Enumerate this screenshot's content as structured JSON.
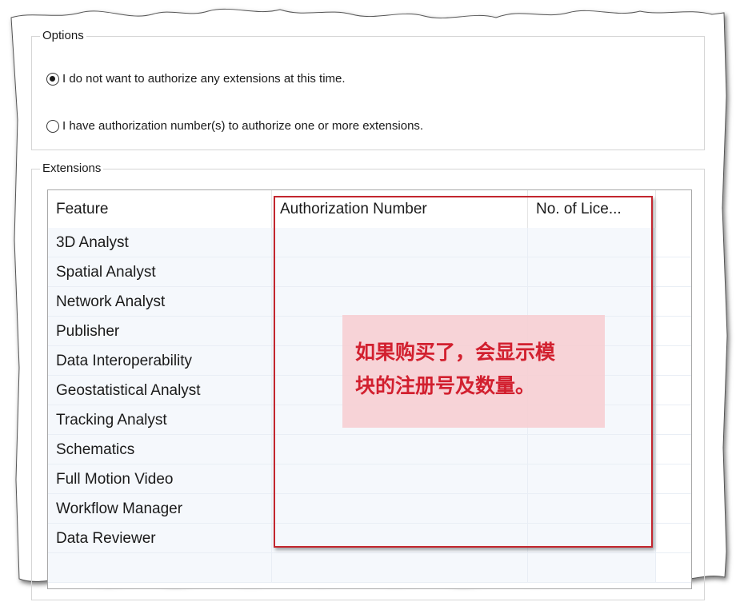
{
  "options": {
    "legend": "Options",
    "radio_no_authorize": {
      "label": "I do not want to authorize any extensions at this time.",
      "checked": true
    },
    "radio_have_numbers": {
      "label": "I have authorization number(s) to authorize one or more extensions.",
      "checked": false
    }
  },
  "extensions": {
    "legend": "Extensions",
    "columns": [
      "Feature",
      "Authorization Number",
      "No. of Lice..."
    ],
    "rows": [
      {
        "feature": "3D Analyst",
        "auth": "",
        "count": ""
      },
      {
        "feature": "Spatial Analyst",
        "auth": "",
        "count": ""
      },
      {
        "feature": "Network Analyst",
        "auth": "",
        "count": ""
      },
      {
        "feature": "Publisher",
        "auth": "",
        "count": ""
      },
      {
        "feature": "Data Interoperability",
        "auth": "",
        "count": ""
      },
      {
        "feature": "Geostatistical Analyst",
        "auth": "",
        "count": ""
      },
      {
        "feature": "Tracking Analyst",
        "auth": "",
        "count": ""
      },
      {
        "feature": "Schematics",
        "auth": "",
        "count": ""
      },
      {
        "feature": "Full Motion Video",
        "auth": "",
        "count": ""
      },
      {
        "feature": "Workflow Manager",
        "auth": "",
        "count": ""
      },
      {
        "feature": "Data Reviewer",
        "auth": "",
        "count": ""
      }
    ]
  },
  "annotation": {
    "line1": "如果购买了，会显示模",
    "line2": "块的注册号及数量。",
    "border_color": "#c3262e",
    "text_color": "#d2202f",
    "fill_color": "#f7cdd0"
  }
}
